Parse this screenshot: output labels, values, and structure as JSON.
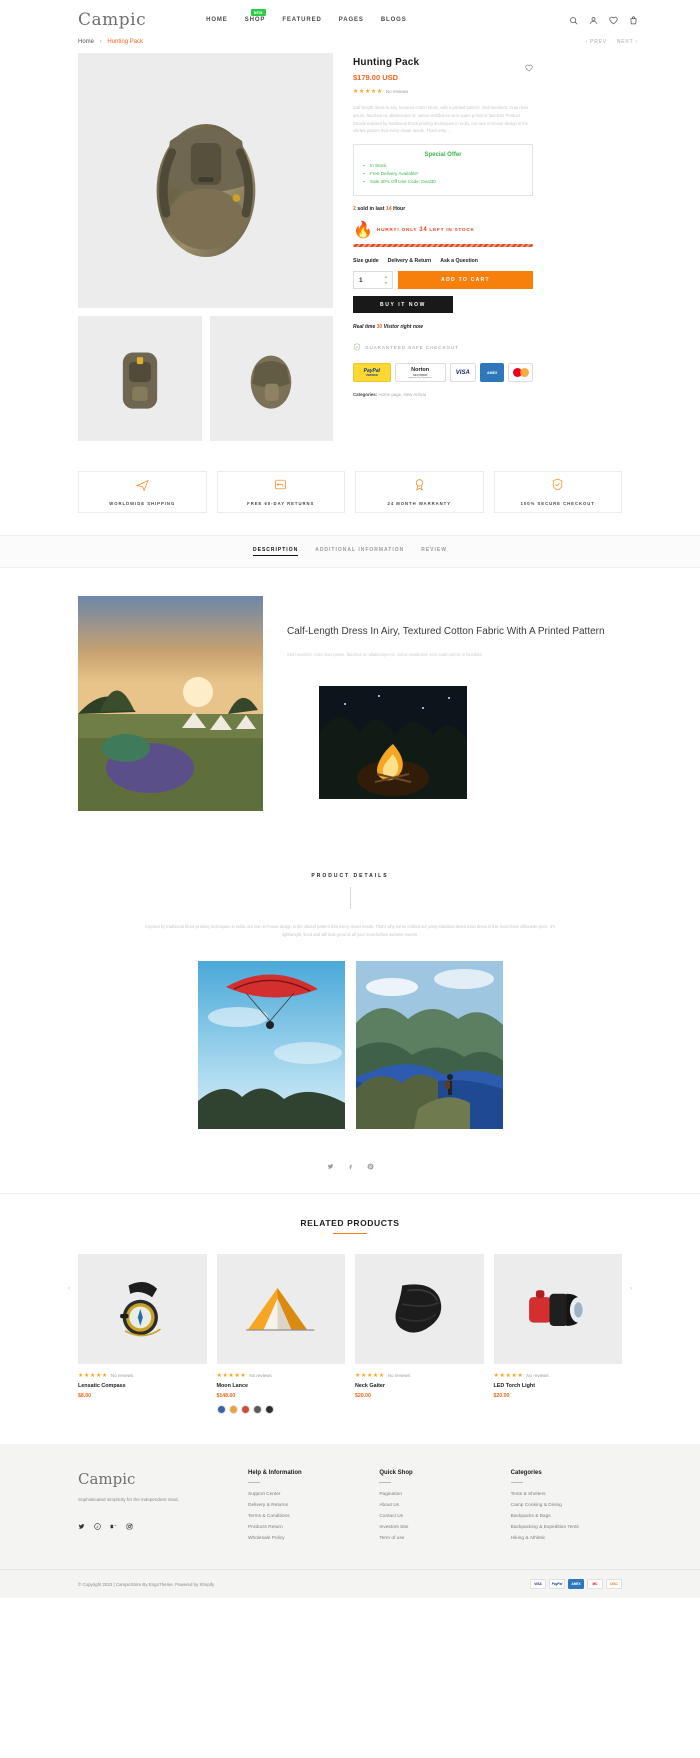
{
  "header": {
    "logo": "Campic",
    "nav": [
      {
        "label": "HOME",
        "badge": ""
      },
      {
        "label": "SHOP",
        "badge": "NEW"
      },
      {
        "label": "FEATURED",
        "badge": ""
      },
      {
        "label": "PAGES",
        "badge": ""
      },
      {
        "label": "BLOGS",
        "badge": ""
      }
    ],
    "icons": [
      "search-icon",
      "account-icon",
      "wishlist-icon",
      "cart-icon"
    ]
  },
  "breadcrumb": {
    "home": "Home",
    "sep": "›",
    "current": "Hunting Pack",
    "prev": "‹ PREV",
    "next": "NEXT ›"
  },
  "product": {
    "title": "Hunting Pack",
    "price": "$179.00 USD",
    "stars": "★★★★★",
    "reviews": "No reviews",
    "description": "Calf-length dress in airy, textured cotton fabric, with a printed pattern. Sed hendrerit. Cras risus ipsum, faucibus ut, ullamcorper id, varius vestibulum sem quam primis in faucibus Product Details Inspired by traditional block-printing techniques in India, our own in-house design is the vibrant pattern that every closet needs. That's why ...",
    "offer": {
      "title": "Special Offer",
      "items": [
        "In Stock",
        "Free Delivery Available*",
        "Sale 30% Off Use Code: Deal30"
      ]
    },
    "sold_pre": "2",
    "sold_mid": "sold in last",
    "sold_hours": "14",
    "sold_post": "Hour",
    "hurry_pre": "HURRY! ONLY",
    "hurry_qty": "34",
    "hurry_post": "LEFT IN STOCK",
    "minitabs": [
      "Size guide",
      "Delivery & Return",
      "Ask a Question"
    ],
    "qty": "1",
    "add_to_cart": "ADD TO CART",
    "buy_it_now": "BUY IT NOW",
    "realtime_pre": "Real time",
    "realtime_count": "30",
    "realtime_post": "Visitor right now",
    "safe_checkout": "GUARANTEED SAFE CHECKOUT",
    "payments": [
      {
        "name": "paypal-badge",
        "l1": "PayPal",
        "l2": "VERIFIED"
      },
      {
        "name": "norton-badge",
        "l1": "Norton",
        "l2": "SECURED"
      },
      {
        "name": "visa-badge",
        "l1": "VISA",
        "l2": ""
      },
      {
        "name": "amex-badge",
        "l1": "AMEX",
        "l2": ""
      },
      {
        "name": "mastercard-badge",
        "l1": "",
        "l2": ""
      }
    ],
    "norton_sub": "powered by Symantec",
    "categories_label": "Categories:",
    "categories_value": "Home page, New Arrival"
  },
  "badges": [
    {
      "icon": "plane-icon",
      "label": "WORLDWIDE SHIPPING"
    },
    {
      "icon": "return-box-icon",
      "label": "FREE 60-DAY RETURNS"
    },
    {
      "icon": "medal-icon",
      "label": "24 MONTH WARRANTY"
    },
    {
      "icon": "shield-check-icon",
      "label": "100% SECURE CHECKOUT"
    }
  ],
  "tabs": [
    {
      "label": "DESCRIPTION",
      "active": true
    },
    {
      "label": "ADDITIONAL INFORMATION",
      "active": false
    },
    {
      "label": "REVIEW",
      "active": false
    }
  ],
  "description": {
    "heading": "Calf-Length Dress In Airy, Textured Cotton Fabric With A Printed Pattern",
    "body": "Sed hendrerit. Cras risus ipsum, faucibus ut, ullamcorper id, varius vestibulum sem quam primis in faucibus.",
    "details_title": "PRODUCT DETAILS",
    "details_body": "Inspired by traditional block-printing techniques in India, our own in-house design is the vibrant pattern that every closet needs. That's why we've crafted our party-standard tiered maxi dress in this must-have silhouette price. It's lightweight, lined and will look great at all your must-before summer events.",
    "share": [
      "twitter-icon",
      "facebook-icon",
      "pinterest-icon"
    ]
  },
  "related": {
    "heading": "RELATED PRODUCTS",
    "prev_arrow": "‹",
    "next_arrow": "›",
    "items": [
      {
        "name": "Lensatic Compass",
        "price": "$8.00",
        "stars": "★★★★★",
        "reviews": "No reviews",
        "swatches": []
      },
      {
        "name": "Moon Lance",
        "price": "$148.00",
        "stars": "★★★★★",
        "reviews": "No reviews",
        "swatches": [
          "#3b63a8",
          "#e8a33d",
          "#c94f3a",
          "#5b5b5b",
          "#2f2f2f"
        ]
      },
      {
        "name": "Neck Gaiter",
        "price": "$20.00",
        "stars": "★★★★★",
        "reviews": "No reviews",
        "swatches": []
      },
      {
        "name": "LED Torch Light",
        "price": "$20.00",
        "stars": "★★★★★",
        "reviews": "No reviews",
        "swatches": []
      }
    ]
  },
  "footer": {
    "logo": "Campic",
    "tagline": "Sophisticated simplicity for the independent mind.",
    "social": [
      "twitter-icon",
      "pinterest-icon",
      "behance-icon",
      "instagram-icon"
    ],
    "columns": [
      {
        "title": "Help & Information",
        "links": [
          "Support Center",
          "Delivery & Returns",
          "Terms & Conditions",
          "Products Return",
          "Wholesale Policy"
        ]
      },
      {
        "title": "Quick Shop",
        "links": [
          "Pagination",
          "About Us",
          "Contact Us",
          "Investors Site",
          "Term of use"
        ]
      },
      {
        "title": "Categories",
        "links": [
          "Tents & Shelters",
          "Camp Cooking & Dining",
          "Backpacks & Bags",
          "Backpacking & Expedition Tents",
          "Hiking & Athletic"
        ]
      }
    ],
    "copyright": "© Copyright 2023 | CampicStore By EngoTheme. Powered by Shopify",
    "cards": [
      "VISA",
      "PayPal",
      "AMEX",
      "MC",
      "DISC"
    ]
  },
  "colors": {
    "accent": "#f7800c",
    "price": "#f0661d",
    "green": "#3cb84b",
    "urgent": "#e8431f",
    "dark": "#191919"
  }
}
